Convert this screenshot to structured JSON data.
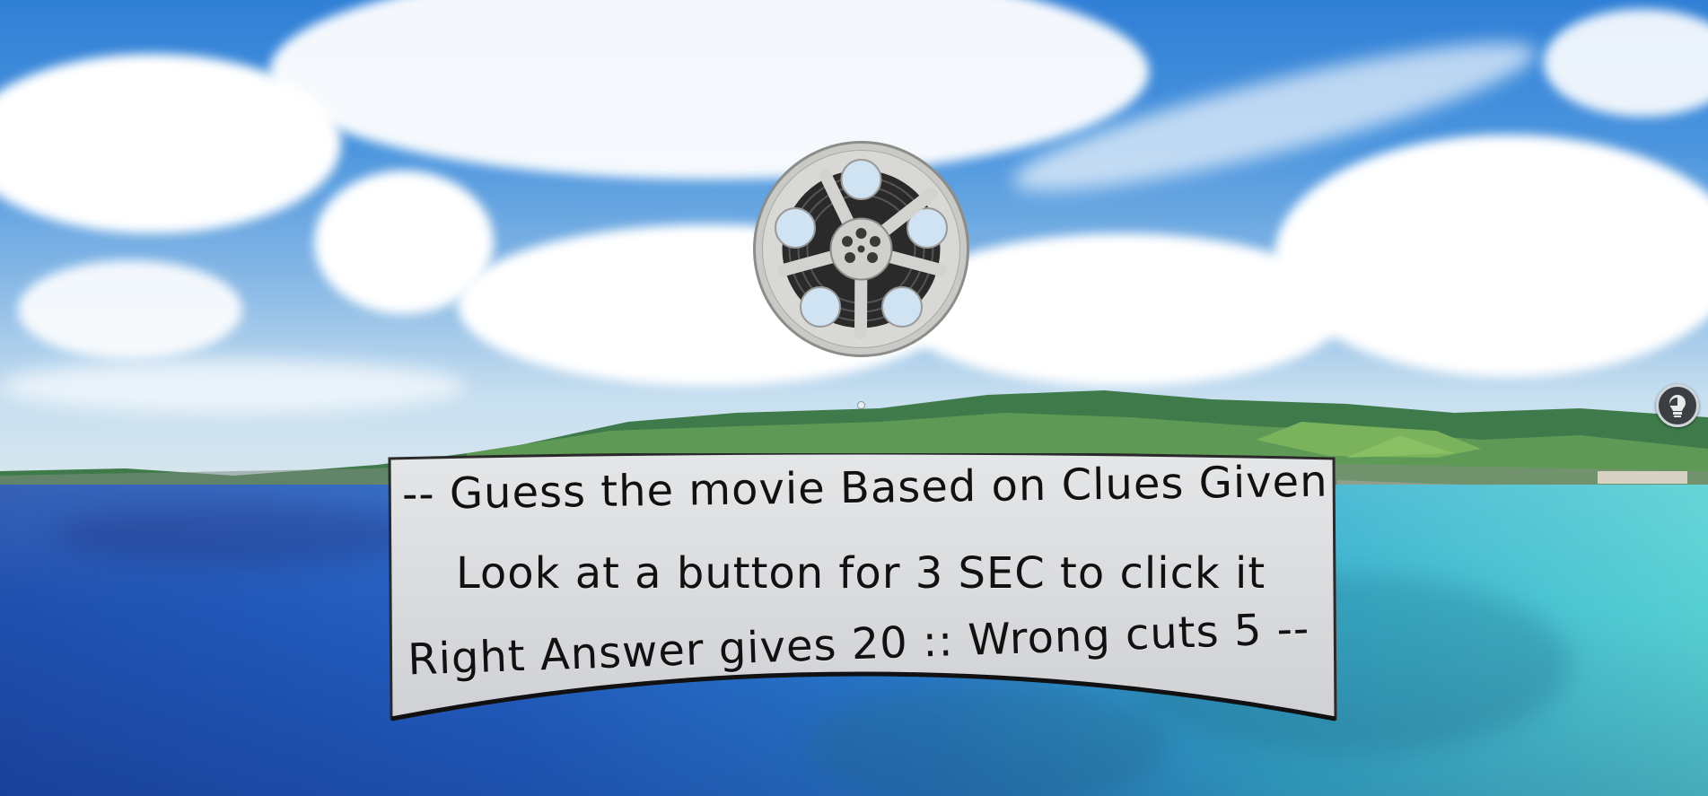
{
  "instructions": {
    "line1": "-- Guess the movie Based on Clues Given",
    "line2": "Look at a button for 3 SEC to click it",
    "line3": "Right Answer gives 20 :: Wrong cuts 5 --"
  },
  "icons": {
    "reel": "film-reel-icon",
    "help": "help-bulb-icon",
    "gaze": "gaze-cursor"
  },
  "colors": {
    "panel": "#d6d8dc",
    "text": "#111111",
    "sky": "#4b95de",
    "sea": "#2361c4"
  }
}
